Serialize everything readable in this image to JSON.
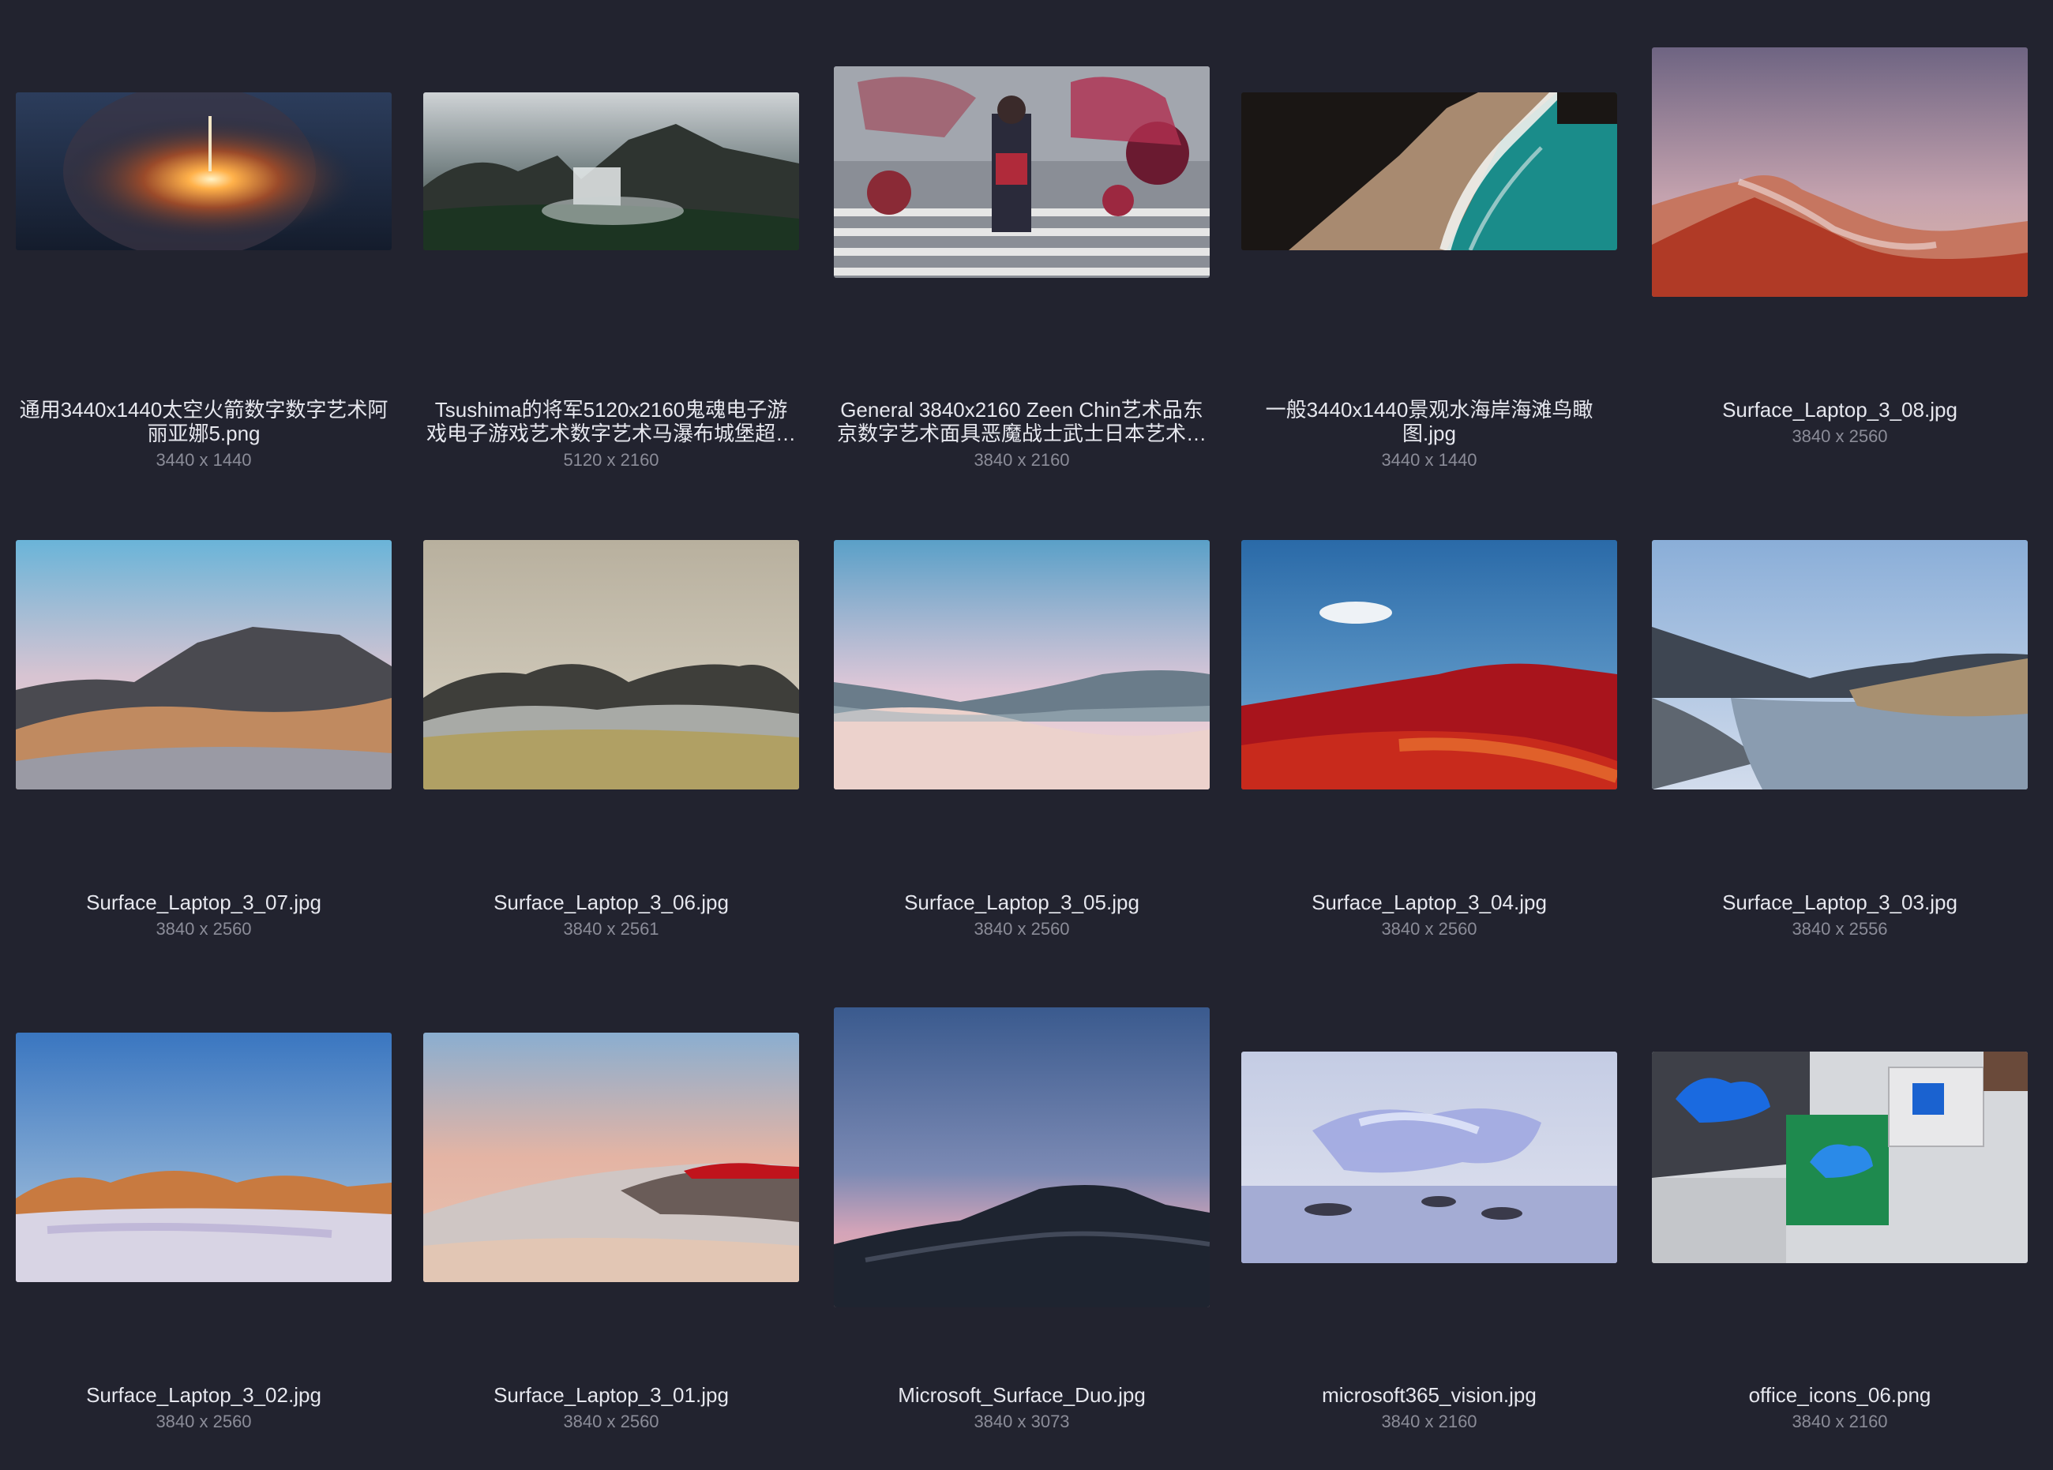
{
  "items": [
    {
      "name": "通用3440x1440太空火箭数字数字艺术阿丽亚娜5.png",
      "dims": "3440 x 1440",
      "thumb": "rocket-launch-night"
    },
    {
      "name": "Tsushima的将军5120x2160鬼魂电子游戏电子游戏艺术数字艺术马瀑布城堡超…",
      "dims": "5120 x 2160",
      "thumb": "waterfall-castle-landscape"
    },
    {
      "name": "General 3840x2160 Zeen Chin艺术品东京数字艺术面具恶魔战士武士日本艺术…",
      "dims": "3840 x 2160",
      "thumb": "tokyo-masks-crowd"
    },
    {
      "name": "一般3440x1440景观水海岸海滩鸟瞰图.jpg",
      "dims": "3440 x 1440",
      "thumb": "aerial-beach-coast"
    },
    {
      "name": "Surface_Laptop_3_08.jpg",
      "dims": "3840 x 2560",
      "thumb": "red-mountain-dusk"
    },
    {
      "name": "Surface_Laptop_3_07.jpg",
      "dims": "3840 x 2560",
      "thumb": "gray-mountain-dunes"
    },
    {
      "name": "Surface_Laptop_3_06.jpg",
      "dims": "3840 x 2561",
      "thumb": "grass-hills-beige-sky"
    },
    {
      "name": "Surface_Laptop_3_05.jpg",
      "dims": "3840 x 2560",
      "thumb": "pink-sand-dune"
    },
    {
      "name": "Surface_Laptop_3_04.jpg",
      "dims": "3840 x 2560",
      "thumb": "red-dunes-cloud"
    },
    {
      "name": "Surface_Laptop_3_03.jpg",
      "dims": "3840 x 2556",
      "thumb": "lake-hills-reeds"
    },
    {
      "name": "Surface_Laptop_3_02.jpg",
      "dims": "3840 x 2560",
      "thumb": "orange-hills-snow"
    },
    {
      "name": "Surface_Laptop_3_01.jpg",
      "dims": "3840 x 2560",
      "thumb": "sand-dune-red-rock"
    },
    {
      "name": "Microsoft_Surface_Duo.jpg",
      "dims": "3840 x 3073",
      "thumb": "dark-mountain-dusk"
    },
    {
      "name": "microsoft365_vision.jpg",
      "dims": "3840 x 2160",
      "thumb": "glass-sculpture-water"
    },
    {
      "name": "office_icons_06.png",
      "dims": "3840 x 2160",
      "thumb": "office-desk-onedrive"
    }
  ]
}
